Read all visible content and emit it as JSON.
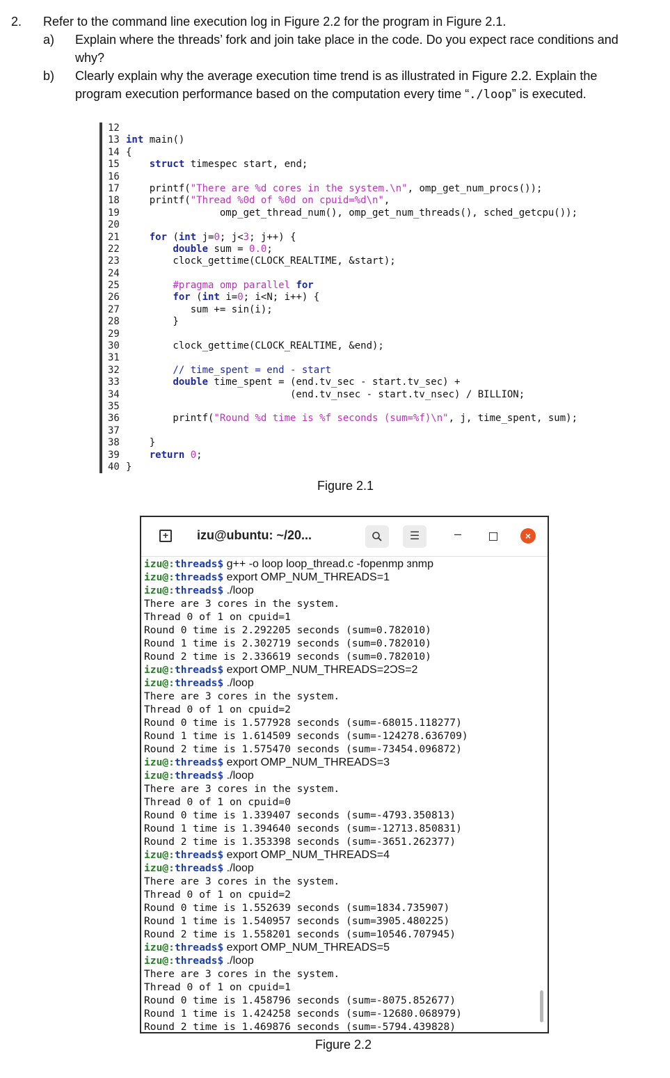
{
  "question": {
    "number": "2.",
    "stem": "Refer to the command line execution log in Figure 2.2 for the program in Figure 2.1.",
    "part_a_label": "a)",
    "part_a_line1": "Explain where the threads’ fork and join take place in the code. Do you expect race conditions and",
    "part_a_line2": "why?",
    "part_b_label": "b)",
    "part_b_line1": "Clearly explain why the average execution time trend is as illustrated in Figure 2.2. Explain the",
    "part_b_line2_pre": "program execution performance based on the computation every time “",
    "part_b_cmd": "./loop",
    "part_b_line2_post": "” is executed."
  },
  "code": {
    "lines": [
      {
        "n": "12",
        "t": ""
      },
      {
        "n": "13",
        "t": "int main()"
      },
      {
        "n": "14",
        "t": "{"
      },
      {
        "n": "15",
        "t": "    struct timespec start, end;"
      },
      {
        "n": "16",
        "t": ""
      },
      {
        "n": "17",
        "t": "    printf(\"There are %d cores in the system.\\n\", omp_get_num_procs());"
      },
      {
        "n": "18",
        "t": "    printf(\"Thread %0d of %0d on cpuid=%d\\n\","
      },
      {
        "n": "19",
        "t": "                omp_get_thread_num(), omp_get_num_threads(), sched_getcpu());"
      },
      {
        "n": "20",
        "t": ""
      },
      {
        "n": "21",
        "t": "    for (int j=0; j<3; j++) {"
      },
      {
        "n": "22",
        "t": "        double sum = 0.0;"
      },
      {
        "n": "23",
        "t": "        clock_gettime(CLOCK_REALTIME, &start);"
      },
      {
        "n": "24",
        "t": ""
      },
      {
        "n": "25",
        "t": "        #pragma omp parallel for"
      },
      {
        "n": "26",
        "t": "        for (int i=0; i<N; i++) {"
      },
      {
        "n": "27",
        "t": "           sum += sin(i);"
      },
      {
        "n": "28",
        "t": "        }"
      },
      {
        "n": "29",
        "t": ""
      },
      {
        "n": "30",
        "t": "        clock_gettime(CLOCK_REALTIME, &end);"
      },
      {
        "n": "31",
        "t": ""
      },
      {
        "n": "32",
        "t": "        // time_spent = end - start"
      },
      {
        "n": "33",
        "t": "        double time_spent = (end.tv_sec - start.tv_sec) +"
      },
      {
        "n": "34",
        "t": "                            (end.tv_nsec - start.tv_nsec) / BILLION;"
      },
      {
        "n": "35",
        "t": ""
      },
      {
        "n": "36",
        "t": "        printf(\"Round %d time is %f seconds (sum=%f)\\n\", j, time_spent, sum);"
      },
      {
        "n": "37",
        "t": ""
      },
      {
        "n": "38",
        "t": "    }"
      },
      {
        "n": "39",
        "t": "    return 0;"
      },
      {
        "n": "40",
        "t": "}"
      }
    ]
  },
  "captions": {
    "fig1": "Figure 2.1",
    "fig2": "Figure 2.2"
  },
  "terminal": {
    "title": "izu@ubuntu: ~/20...",
    "icons": {
      "new_tab": "new-tab-icon",
      "search": "search-icon",
      "menu": "hamburger-menu-icon",
      "minimize": "minimize-icon",
      "maximize": "maximize-icon",
      "close": "close-icon"
    },
    "close_color": "#e95420",
    "lines": [
      {
        "p": "izu@:threads$",
        "c": " g++ -o loop loop_thread.c -fopenmp ɜnmp"
      },
      {
        "p": "izu@:threads$",
        "c": " export OMP_NUM_THREADS=1"
      },
      {
        "p": "izu@:threads$",
        "c": " ./loop"
      },
      {
        "p": "",
        "c": "There are 3 cores in the system."
      },
      {
        "p": "",
        "c": "Thread 0 of 1 on cpuid=1"
      },
      {
        "p": "",
        "c": "Round 0 time is 2.292205 seconds (sum=0.782010)"
      },
      {
        "p": "",
        "c": "Round 1 time is 2.302719 seconds (sum=0.782010)"
      },
      {
        "p": "",
        "c": "Round 2 time is 2.336619 seconds (sum=0.782010)"
      },
      {
        "p": "izu@:threads$",
        "c": " export OMP_NUM_THREADS=2ƆS=2"
      },
      {
        "p": "izu@:threads$",
        "c": " ./loop"
      },
      {
        "p": "",
        "c": "There are 3 cores in the system."
      },
      {
        "p": "",
        "c": "Thread 0 of 1 on cpuid=2"
      },
      {
        "p": "",
        "c": "Round 0 time is 1.577928 seconds (sum=-68015.118277)"
      },
      {
        "p": "",
        "c": "Round 1 time is 1.614509 seconds (sum=-124278.636709)"
      },
      {
        "p": "",
        "c": "Round 2 time is 1.575470 seconds (sum=-73454.096872)"
      },
      {
        "p": "izu@:threads$",
        "c": " export OMP_NUM_THREADS=3"
      },
      {
        "p": "izu@:threads$",
        "c": " ./loop"
      },
      {
        "p": "",
        "c": "There are 3 cores in the system."
      },
      {
        "p": "",
        "c": "Thread 0 of 1 on cpuid=0"
      },
      {
        "p": "",
        "c": "Round 0 time is 1.339407 seconds (sum=-4793.350813)"
      },
      {
        "p": "",
        "c": "Round 1 time is 1.394640 seconds (sum=-12713.850831)"
      },
      {
        "p": "",
        "c": "Round 2 time is 1.353398 seconds (sum=-3651.262377)"
      },
      {
        "p": "izu@:threads$",
        "c": " export OMP_NUM_THREADS=4"
      },
      {
        "p": "izu@:threads$",
        "c": " ./loop"
      },
      {
        "p": "",
        "c": "There are 3 cores in the system."
      },
      {
        "p": "",
        "c": "Thread 0 of 1 on cpuid=2"
      },
      {
        "p": "",
        "c": "Round 0 time is 1.552639 seconds (sum=1834.735907)"
      },
      {
        "p": "",
        "c": "Round 1 time is 1.540957 seconds (sum=3905.480225)"
      },
      {
        "p": "",
        "c": "Round 2 time is 1.558201 seconds (sum=10546.707945)"
      },
      {
        "p": "izu@:threads$",
        "c": " export OMP_NUM_THREADS=5"
      },
      {
        "p": "izu@:threads$",
        "c": " ./loop"
      },
      {
        "p": "",
        "c": "There are 3 cores in the system."
      },
      {
        "p": "",
        "c": "Thread 0 of 1 on cpuid=1"
      },
      {
        "p": "",
        "c": "Round 0 time is 1.458796 seconds (sum=-8075.852677)"
      },
      {
        "p": "",
        "c": "Round 1 time is 1.424258 seconds (sum=-12680.068979)"
      },
      {
        "p": "",
        "c": "Round 2 time is 1.469876 seconds (sum=-5794.439828)"
      }
    ]
  }
}
